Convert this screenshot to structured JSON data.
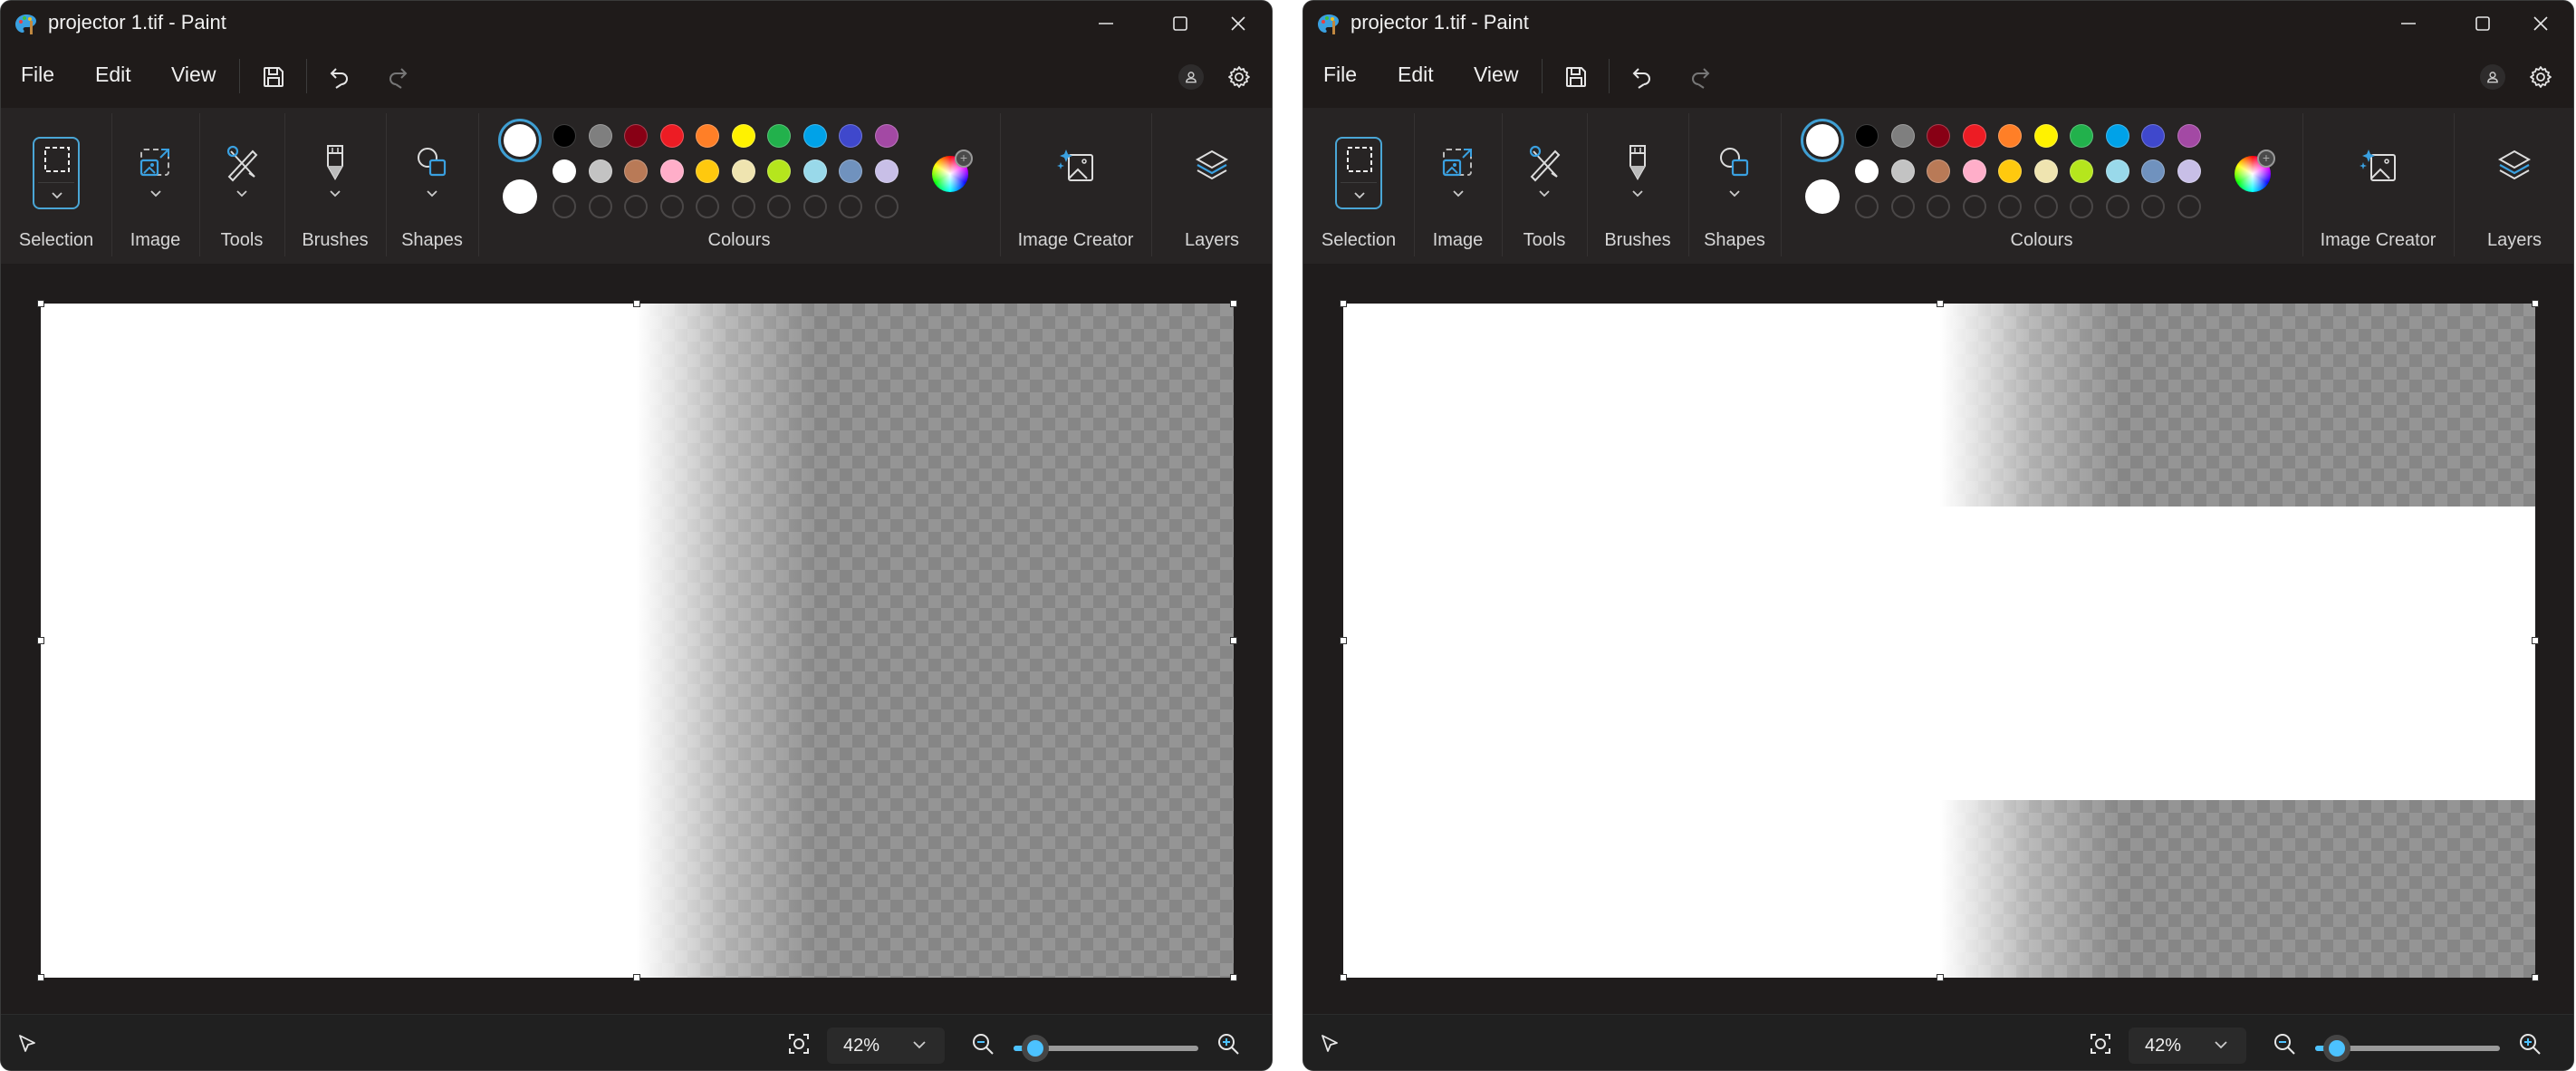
{
  "windows": [
    {
      "id": "left",
      "title": "projector 1.tif - Paint",
      "menu": [
        "File",
        "Edit",
        "View"
      ],
      "ribbon_groups": [
        "Selection",
        "Image",
        "Tools",
        "Brushes",
        "Shapes",
        "Colours",
        "Image Creator",
        "Layers"
      ],
      "zoom_value": "42%",
      "zoom_slider_fraction": 0.06,
      "canvas_content": "white left half, right half transparent with gradient fade"
    },
    {
      "id": "right",
      "title": "projector 1.tif - Paint",
      "menu": [
        "File",
        "Edit",
        "View"
      ],
      "ribbon_groups": [
        "Selection",
        "Image",
        "Tools",
        "Brushes",
        "Shapes",
        "Colours",
        "Image Creator",
        "Layers"
      ],
      "zoom_value": "42%",
      "zoom_slider_fraction": 0.06,
      "canvas_content": "white left half and white middle band on right; right top and bottom transparent with gradient fade"
    }
  ],
  "palette": {
    "primary": "#ffffff",
    "secondary": "#ffffff",
    "row1": [
      "#000000",
      "#7f7f7f",
      "#880015",
      "#ed1c24",
      "#ff7f27",
      "#fff200",
      "#22b14c",
      "#00a2e8",
      "#3f48cc",
      "#a349a4"
    ],
    "row2": [
      "#ffffff",
      "#c3c3c3",
      "#b97a57",
      "#ffaec9",
      "#ffc90e",
      "#efe4b0",
      "#b5e61d",
      "#99d9ea",
      "#7092be",
      "#c8bfe7"
    ],
    "row3_empty_count": 10
  },
  "icons": {
    "app": "paint-palette-icon",
    "minimize": "minimize-icon",
    "maximize": "maximize-icon",
    "close": "close-icon",
    "save": "save-icon",
    "undo": "undo-icon",
    "redo": "redo-icon",
    "account": "account-icon",
    "settings": "gear-icon",
    "pointer": "pointer-icon",
    "fit": "fit-to-window-icon",
    "zoom_out": "zoom-out-icon",
    "zoom_in": "zoom-in-icon"
  },
  "accent_color": "#4cc2ff"
}
